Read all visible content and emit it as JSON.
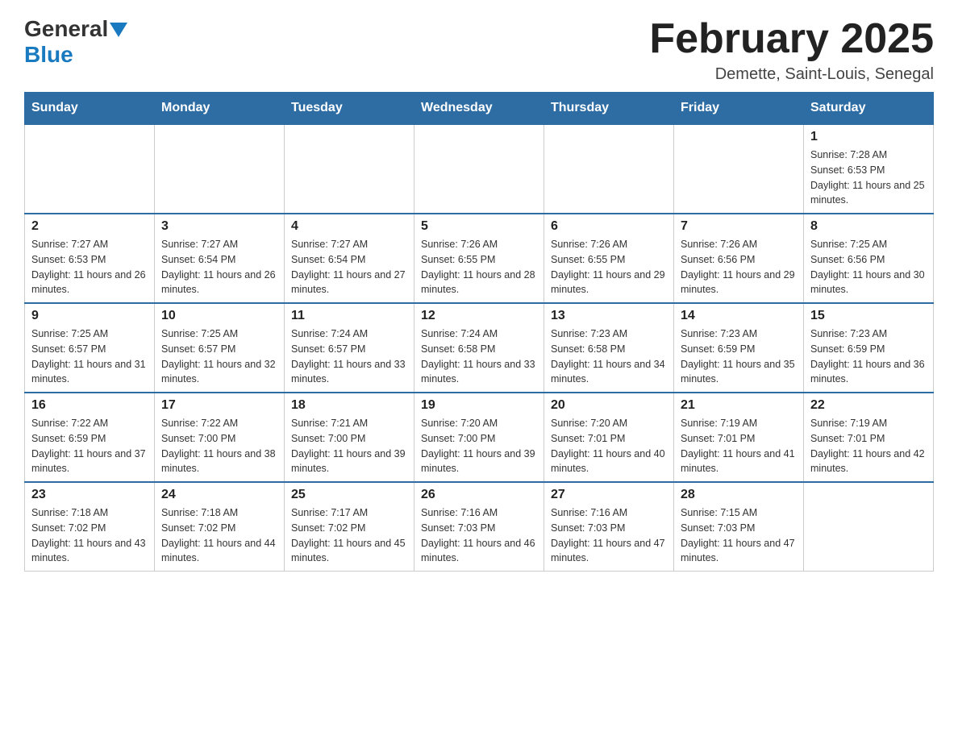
{
  "header": {
    "logo_general": "General",
    "logo_blue": "Blue",
    "title": "February 2025",
    "subtitle": "Demette, Saint-Louis, Senegal"
  },
  "calendar": {
    "days_of_week": [
      "Sunday",
      "Monday",
      "Tuesday",
      "Wednesday",
      "Thursday",
      "Friday",
      "Saturday"
    ],
    "weeks": [
      [
        {
          "day": "",
          "info": ""
        },
        {
          "day": "",
          "info": ""
        },
        {
          "day": "",
          "info": ""
        },
        {
          "day": "",
          "info": ""
        },
        {
          "day": "",
          "info": ""
        },
        {
          "day": "",
          "info": ""
        },
        {
          "day": "1",
          "info": "Sunrise: 7:28 AM\nSunset: 6:53 PM\nDaylight: 11 hours and 25 minutes."
        }
      ],
      [
        {
          "day": "2",
          "info": "Sunrise: 7:27 AM\nSunset: 6:53 PM\nDaylight: 11 hours and 26 minutes."
        },
        {
          "day": "3",
          "info": "Sunrise: 7:27 AM\nSunset: 6:54 PM\nDaylight: 11 hours and 26 minutes."
        },
        {
          "day": "4",
          "info": "Sunrise: 7:27 AM\nSunset: 6:54 PM\nDaylight: 11 hours and 27 minutes."
        },
        {
          "day": "5",
          "info": "Sunrise: 7:26 AM\nSunset: 6:55 PM\nDaylight: 11 hours and 28 minutes."
        },
        {
          "day": "6",
          "info": "Sunrise: 7:26 AM\nSunset: 6:55 PM\nDaylight: 11 hours and 29 minutes."
        },
        {
          "day": "7",
          "info": "Sunrise: 7:26 AM\nSunset: 6:56 PM\nDaylight: 11 hours and 29 minutes."
        },
        {
          "day": "8",
          "info": "Sunrise: 7:25 AM\nSunset: 6:56 PM\nDaylight: 11 hours and 30 minutes."
        }
      ],
      [
        {
          "day": "9",
          "info": "Sunrise: 7:25 AM\nSunset: 6:57 PM\nDaylight: 11 hours and 31 minutes."
        },
        {
          "day": "10",
          "info": "Sunrise: 7:25 AM\nSunset: 6:57 PM\nDaylight: 11 hours and 32 minutes."
        },
        {
          "day": "11",
          "info": "Sunrise: 7:24 AM\nSunset: 6:57 PM\nDaylight: 11 hours and 33 minutes."
        },
        {
          "day": "12",
          "info": "Sunrise: 7:24 AM\nSunset: 6:58 PM\nDaylight: 11 hours and 33 minutes."
        },
        {
          "day": "13",
          "info": "Sunrise: 7:23 AM\nSunset: 6:58 PM\nDaylight: 11 hours and 34 minutes."
        },
        {
          "day": "14",
          "info": "Sunrise: 7:23 AM\nSunset: 6:59 PM\nDaylight: 11 hours and 35 minutes."
        },
        {
          "day": "15",
          "info": "Sunrise: 7:23 AM\nSunset: 6:59 PM\nDaylight: 11 hours and 36 minutes."
        }
      ],
      [
        {
          "day": "16",
          "info": "Sunrise: 7:22 AM\nSunset: 6:59 PM\nDaylight: 11 hours and 37 minutes."
        },
        {
          "day": "17",
          "info": "Sunrise: 7:22 AM\nSunset: 7:00 PM\nDaylight: 11 hours and 38 minutes."
        },
        {
          "day": "18",
          "info": "Sunrise: 7:21 AM\nSunset: 7:00 PM\nDaylight: 11 hours and 39 minutes."
        },
        {
          "day": "19",
          "info": "Sunrise: 7:20 AM\nSunset: 7:00 PM\nDaylight: 11 hours and 39 minutes."
        },
        {
          "day": "20",
          "info": "Sunrise: 7:20 AM\nSunset: 7:01 PM\nDaylight: 11 hours and 40 minutes."
        },
        {
          "day": "21",
          "info": "Sunrise: 7:19 AM\nSunset: 7:01 PM\nDaylight: 11 hours and 41 minutes."
        },
        {
          "day": "22",
          "info": "Sunrise: 7:19 AM\nSunset: 7:01 PM\nDaylight: 11 hours and 42 minutes."
        }
      ],
      [
        {
          "day": "23",
          "info": "Sunrise: 7:18 AM\nSunset: 7:02 PM\nDaylight: 11 hours and 43 minutes."
        },
        {
          "day": "24",
          "info": "Sunrise: 7:18 AM\nSunset: 7:02 PM\nDaylight: 11 hours and 44 minutes."
        },
        {
          "day": "25",
          "info": "Sunrise: 7:17 AM\nSunset: 7:02 PM\nDaylight: 11 hours and 45 minutes."
        },
        {
          "day": "26",
          "info": "Sunrise: 7:16 AM\nSunset: 7:03 PM\nDaylight: 11 hours and 46 minutes."
        },
        {
          "day": "27",
          "info": "Sunrise: 7:16 AM\nSunset: 7:03 PM\nDaylight: 11 hours and 47 minutes."
        },
        {
          "day": "28",
          "info": "Sunrise: 7:15 AM\nSunset: 7:03 PM\nDaylight: 11 hours and 47 minutes."
        },
        {
          "day": "",
          "info": ""
        }
      ]
    ]
  }
}
